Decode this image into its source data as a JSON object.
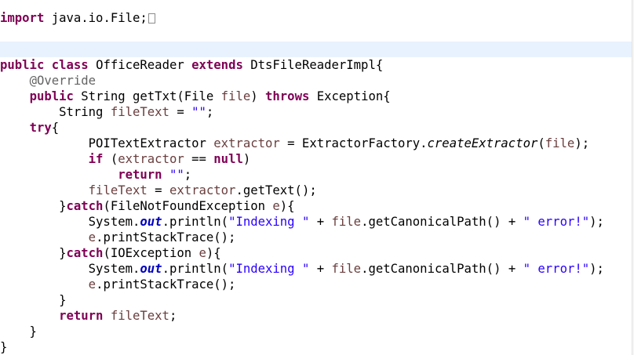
{
  "editor": {
    "lines": [
      [
        {
          "t": "import",
          "c": "keyword"
        },
        {
          "t": " java.io.File;",
          "c": "plain"
        },
        {
          "fold": true
        }
      ],
      [],
      [],
      [
        {
          "t": "public",
          "c": "keyword"
        },
        {
          "t": " ",
          "c": "plain"
        },
        {
          "t": "class",
          "c": "keyword"
        },
        {
          "t": " OfficeReader ",
          "c": "plain"
        },
        {
          "t": "extends",
          "c": "keyword"
        },
        {
          "t": " DtsFileReaderImpl{",
          "c": "plain"
        }
      ],
      [
        {
          "t": "    ",
          "c": "plain"
        },
        {
          "t": "@Override",
          "c": "annotation"
        }
      ],
      [
        {
          "t": "    ",
          "c": "plain"
        },
        {
          "t": "public",
          "c": "keyword"
        },
        {
          "t": " String getTxt(File ",
          "c": "plain"
        },
        {
          "t": "file",
          "c": "variable"
        },
        {
          "t": ") ",
          "c": "plain"
        },
        {
          "t": "throws",
          "c": "keyword"
        },
        {
          "t": " Exception{",
          "c": "plain"
        }
      ],
      [
        {
          "t": "        String ",
          "c": "plain"
        },
        {
          "t": "fileText",
          "c": "variable"
        },
        {
          "t": " = ",
          "c": "plain"
        },
        {
          "t": "\"\"",
          "c": "string"
        },
        {
          "t": ";",
          "c": "plain"
        }
      ],
      [
        {
          "t": "    ",
          "c": "plain"
        },
        {
          "t": "try",
          "c": "keyword"
        },
        {
          "t": "{",
          "c": "plain"
        }
      ],
      [
        {
          "t": "            POITextExtractor ",
          "c": "plain"
        },
        {
          "t": "extractor",
          "c": "variable"
        },
        {
          "t": " = ExtractorFactory.",
          "c": "plain"
        },
        {
          "t": "createExtractor",
          "c": "method-static"
        },
        {
          "t": "(",
          "c": "plain"
        },
        {
          "t": "file",
          "c": "variable"
        },
        {
          "t": ");",
          "c": "plain"
        }
      ],
      [
        {
          "t": "            ",
          "c": "plain"
        },
        {
          "t": "if",
          "c": "keyword"
        },
        {
          "t": " (",
          "c": "plain"
        },
        {
          "t": "extractor",
          "c": "variable"
        },
        {
          "t": " == ",
          "c": "plain"
        },
        {
          "t": "null",
          "c": "keyword"
        },
        {
          "t": ")",
          "c": "plain"
        }
      ],
      [
        {
          "t": "                ",
          "c": "plain"
        },
        {
          "t": "return",
          "c": "keyword"
        },
        {
          "t": " ",
          "c": "plain"
        },
        {
          "t": "\"\"",
          "c": "string"
        },
        {
          "t": ";",
          "c": "plain"
        }
      ],
      [
        {
          "t": "            ",
          "c": "plain"
        },
        {
          "t": "fileText",
          "c": "variable"
        },
        {
          "t": " = ",
          "c": "plain"
        },
        {
          "t": "extractor",
          "c": "variable"
        },
        {
          "t": ".getText();",
          "c": "plain"
        }
      ],
      [
        {
          "t": "        }",
          "c": "plain"
        },
        {
          "t": "catch",
          "c": "keyword"
        },
        {
          "t": "(FileNotFoundException ",
          "c": "plain"
        },
        {
          "t": "e",
          "c": "variable"
        },
        {
          "t": "){",
          "c": "plain"
        }
      ],
      [
        {
          "t": "            System.",
          "c": "plain"
        },
        {
          "t": "out",
          "c": "static"
        },
        {
          "t": ".println(",
          "c": "plain"
        },
        {
          "t": "\"Indexing \"",
          "c": "string"
        },
        {
          "t": " + ",
          "c": "plain"
        },
        {
          "t": "file",
          "c": "variable"
        },
        {
          "t": ".getCanonicalPath() + ",
          "c": "plain"
        },
        {
          "t": "\" error!\"",
          "c": "string"
        },
        {
          "t": ");",
          "c": "plain"
        }
      ],
      [
        {
          "t": "            ",
          "c": "plain"
        },
        {
          "t": "e",
          "c": "variable"
        },
        {
          "t": ".printStackTrace();",
          "c": "plain"
        }
      ],
      [
        {
          "t": "        }",
          "c": "plain"
        },
        {
          "t": "catch",
          "c": "keyword"
        },
        {
          "t": "(IOException ",
          "c": "plain"
        },
        {
          "t": "e",
          "c": "variable"
        },
        {
          "t": "){",
          "c": "plain"
        }
      ],
      [
        {
          "t": "            System.",
          "c": "plain"
        },
        {
          "t": "out",
          "c": "static"
        },
        {
          "t": ".println(",
          "c": "plain"
        },
        {
          "t": "\"Indexing \"",
          "c": "string"
        },
        {
          "t": " + ",
          "c": "plain"
        },
        {
          "t": "file",
          "c": "variable"
        },
        {
          "t": ".getCanonicalPath() + ",
          "c": "plain"
        },
        {
          "t": "\" error!\"",
          "c": "string"
        },
        {
          "t": ");",
          "c": "plain"
        }
      ],
      [
        {
          "t": "            ",
          "c": "plain"
        },
        {
          "t": "e",
          "c": "variable"
        },
        {
          "t": ".printStackTrace();",
          "c": "plain"
        }
      ],
      [
        {
          "t": "        }",
          "c": "plain"
        }
      ],
      [
        {
          "t": "        ",
          "c": "plain"
        },
        {
          "t": "return",
          "c": "keyword"
        },
        {
          "t": " ",
          "c": "plain"
        },
        {
          "t": "fileText",
          "c": "variable"
        },
        {
          "t": ";",
          "c": "plain"
        }
      ],
      [
        {
          "t": "    }",
          "c": "plain"
        }
      ],
      [
        {
          "t": "}",
          "c": "plain"
        }
      ]
    ],
    "current_line": 2,
    "colors": {
      "keyword": "#7f0055",
      "annotation": "#646464",
      "variable": "#6a3e3e",
      "string": "#2a00ff",
      "static_field": "#0000c0",
      "current_line_highlight": "#e8f2fe",
      "background": "#ffffff"
    }
  }
}
